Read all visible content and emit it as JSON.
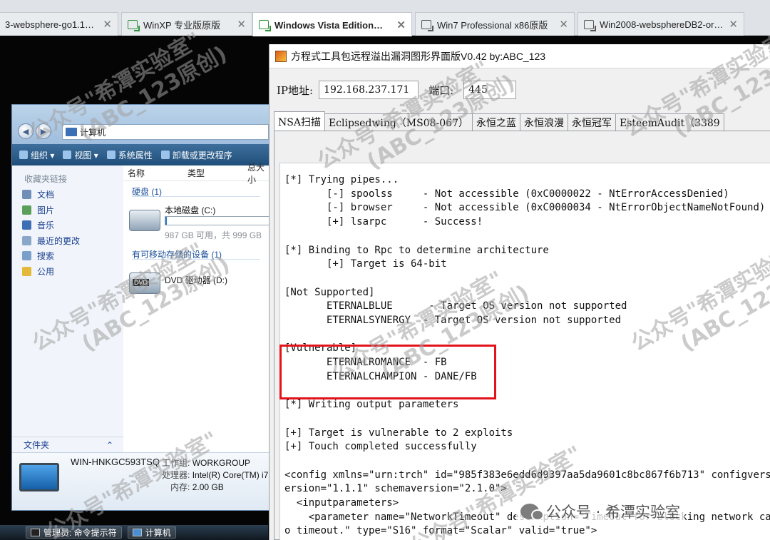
{
  "browser_tabs": [
    {
      "label": "3-websphere-go1.10.8-...",
      "close": "✕"
    },
    {
      "label": "WinXP 专业版原版",
      "close": "✕"
    },
    {
      "label": "Windows Vista Edition原版",
      "close": "✕"
    },
    {
      "label": "Win7 Professional x86原版",
      "close": "✕"
    },
    {
      "label": "Win2008-websphereDB2-oracle...",
      "close": "✕"
    }
  ],
  "explorer": {
    "address": "计算机",
    "toolbar": [
      "组织 ▾",
      "视图 ▾",
      "系统属性",
      "卸载或更改程序"
    ],
    "sidebar_header": "收藏夹链接",
    "sidebar_items": [
      "文档",
      "图片",
      "音乐",
      "最近的更改",
      "搜索",
      "公用"
    ],
    "folders_label": "文件夹",
    "folders_chevron": "⌃",
    "columns": [
      "名称",
      "类型",
      "总大小"
    ],
    "group_hdd": "硬盘 (1)",
    "drive_c": {
      "name": "本地磁盘 (C:)",
      "free": "987 GB 可用，共 999 GB",
      "used_fraction": 0.012
    },
    "group_removable": "有可移动存储的设备 (1)",
    "drive_d": {
      "name": "DVD 驱动器 (D:)"
    },
    "details": {
      "computer_name": "WIN-HNKGC593TSQ",
      "workgroup_label": "工作组:",
      "workgroup": "WORKGROUP",
      "cpu_label": "处理器:",
      "cpu": "Intel(R) Core(TM) i7",
      "mem_label": "内存:",
      "mem": "2.00 GB"
    }
  },
  "taskbar": [
    "管理员: 命令提示符",
    "计算机"
  ],
  "tool": {
    "title": "方程式工具包远程溢出漏洞图形界面版V0.42 by:ABC_123",
    "ip_label": "IP地址:",
    "ip_value": "192.168.237.171",
    "port_label": "端口:",
    "port_value": "445",
    "tabs": [
      "NSA扫描",
      "Eclipsedwing（MS08-067）",
      "永恒之蓝",
      "永恒浪漫",
      "永恒冠军",
      "EsteemAudit（3389"
    ],
    "console_lines": [
      "[*] Trying pipes...",
      "       [-] spoolss     - Not accessible (0xC0000022 - NtErrorAccessDenied)",
      "       [-] browser     - Not accessible (0xC0000034 - NtErrorObjectNameNotFound)",
      "       [+] lsarpc      - Success!",
      "",
      "[*] Binding to Rpc to determine architecture",
      "       [+] Target is 64-bit",
      "",
      "[Not Supported]",
      "       ETERNALBLUE      - Target OS version not supported",
      "       ETERNALSYNERGY  - Target OS version not supported",
      "",
      "[Vulnerable]",
      "       ETERNALROMANCE  - FB",
      "       ETERNALCHAMPION - DANE/FB",
      "",
      "[*] Writing output parameters",
      "",
      "[+] Target is vulnerable to 2 exploits",
      "[+] Touch completed successfully",
      "",
      "<config xmlns=\"urn:trch\" id=\"985f383e6edd6d9397aa5da9601c8bc867f6b713\" configversion=\"1.1.1\" schemaversion=\"2.1.0\">",
      "ersion=\"1.1.1\" schemaversion=\"2.1.0\">",
      "  <inputparameters>",
      "    <parameter name=\"NetworkTimeout\" description=\"Timeout for blocking network ca",
      "o timeout.\" type=\"S16\" format=\"Scalar\" valid=\"true\">"
    ]
  },
  "watermarks": {
    "main": "公众号\"希潭实验室\"",
    "sub": "(ABC_123原创)",
    "footer": "公众号 · 希潭实验室"
  },
  "colors": {
    "highlight_box": "#e3131b",
    "toolbar": "#1f4e7a",
    "link": "#1a3f8f"
  }
}
